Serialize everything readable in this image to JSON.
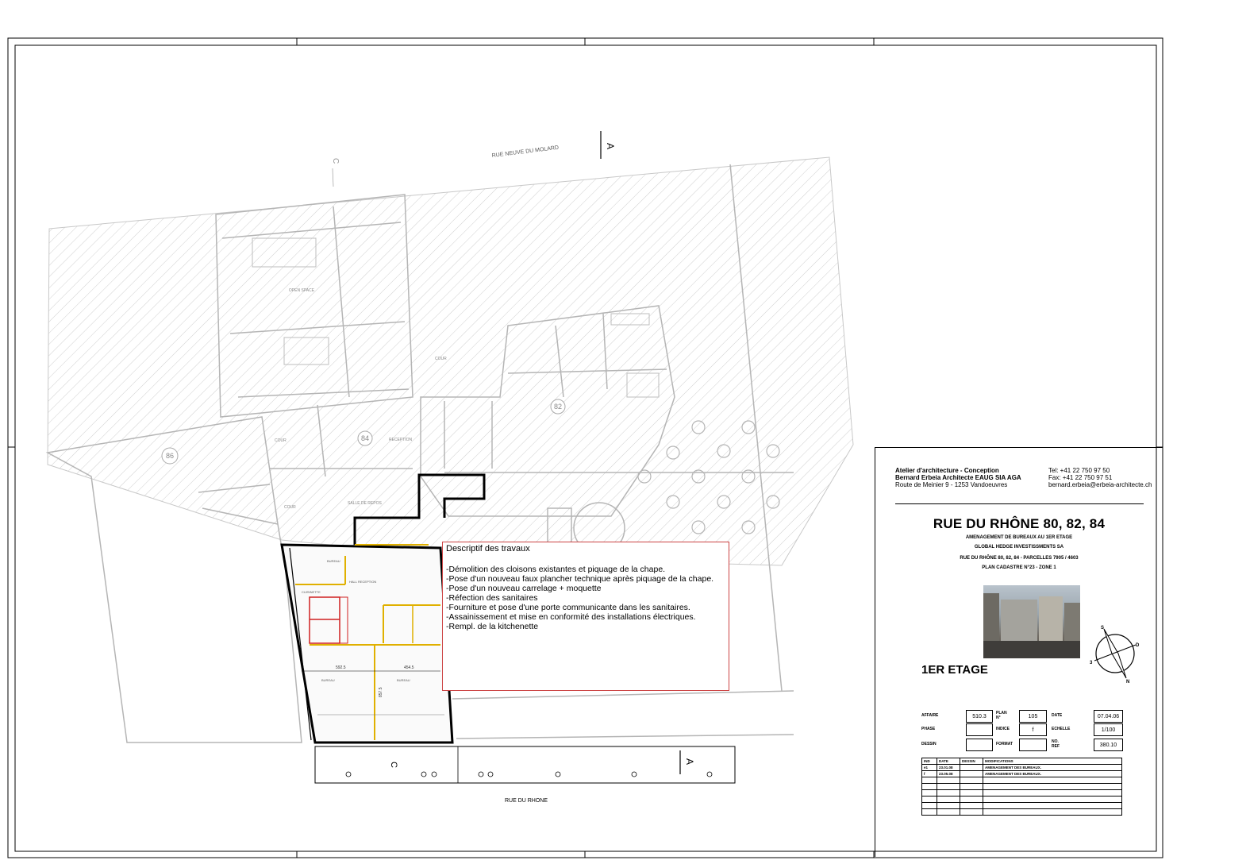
{
  "street_top": "RUE NEUVE DU MOLARD",
  "street_bottom": "RUE DU RHONE",
  "section_marker": "A",
  "grid_marker_c": "C",
  "building_numbers": [
    "86",
    "84",
    "82"
  ],
  "room_labels": {
    "open_space": "OPEN SPACE",
    "cour": "COUR",
    "bureau": "BUREAU",
    "hall_reception": "HALL RECEPTION",
    "cuisinette": "CUISINETTE",
    "reception": "RECEPTION",
    "salle_de_repos": "SALLE DE REPOS"
  },
  "dimensions": [
    "592.5",
    "454.5",
    "857.5"
  ],
  "description": {
    "title": "Descriptif des travaux",
    "items": [
      "-Démolition des cloisons existantes et piquage de la chape.",
      "-Pose d'un nouveau faux plancher technique après piquage de la chape.",
      "-Pose d'un nouveau carrelage + moquette",
      "-Réfection des sanitaires",
      "-Fourniture et pose d'une porte communicante dans les sanitaires.",
      "-Assainissement et mise en conformité des installations électriques.",
      "-Rempl. de la kitchenette"
    ]
  },
  "title_block": {
    "office_line1": "Atelier d'architecture - Conception",
    "office_line2": "Bernard Erbeia Architecte EAUG SIA AGA",
    "office_line3": "Route de Meinier 9 - 1253 Vandoeuvres",
    "tel": "Tel: +41 22 750 97 50",
    "fax": "Fax: +41 22 750 97 51",
    "email": "bernard.erbeia@erbeia-architecte.ch",
    "project_title": "RUE DU RHÔNE 80, 82, 84",
    "subtitle1": "AMENAGEMENT DE BUREAUX AU 1ER ETAGE",
    "subtitle2": "GLOBAL HEDGE INVESTISSMENTS SA",
    "subtitle3": "RUE DU RHÔNE 80, 82, 84 - PARCELLES 7905 / 4603",
    "subtitle4": "PLAN CADASTRE N°23 - ZONE 1",
    "floor_label": "1ER ETAGE",
    "fields": {
      "affaire_label": "AFFAIRE",
      "affaire_value": "510.3",
      "phase_label": "PHASE",
      "phase_value": "",
      "dessin_label": "DESSIN",
      "dessin_value": "",
      "plan_label": "PLAN N°",
      "plan_value": "105",
      "indice_label": "INDICE",
      "indice_value": "f",
      "format_label": "FORMAT",
      "format_value": "",
      "date_label": "DATE",
      "date_value": "07.04.06",
      "echelle_label": "ECHELLE",
      "echelle_value": "1/100",
      "ref_label": "NO. REF",
      "ref_value": "380.10"
    },
    "modifications_headers": [
      "IND",
      "DATE",
      "DESSIN",
      "MODIFICATIONS"
    ],
    "modifications_rows": [
      [
        "e1",
        "23.01.08",
        "",
        "AMENAGEMENT DES BUREAUX."
      ],
      [
        "f",
        "23.05.08",
        "",
        "AMENAGEMENT DES BUREAUX."
      ]
    ],
    "compass_labels": [
      "S",
      "D",
      "3",
      "N"
    ]
  },
  "colors": {
    "highlight_wall": "#e0b000",
    "sanitary_red": "#d02020",
    "desc_border": "#cc4444",
    "hatch": "#c8c8c8"
  }
}
